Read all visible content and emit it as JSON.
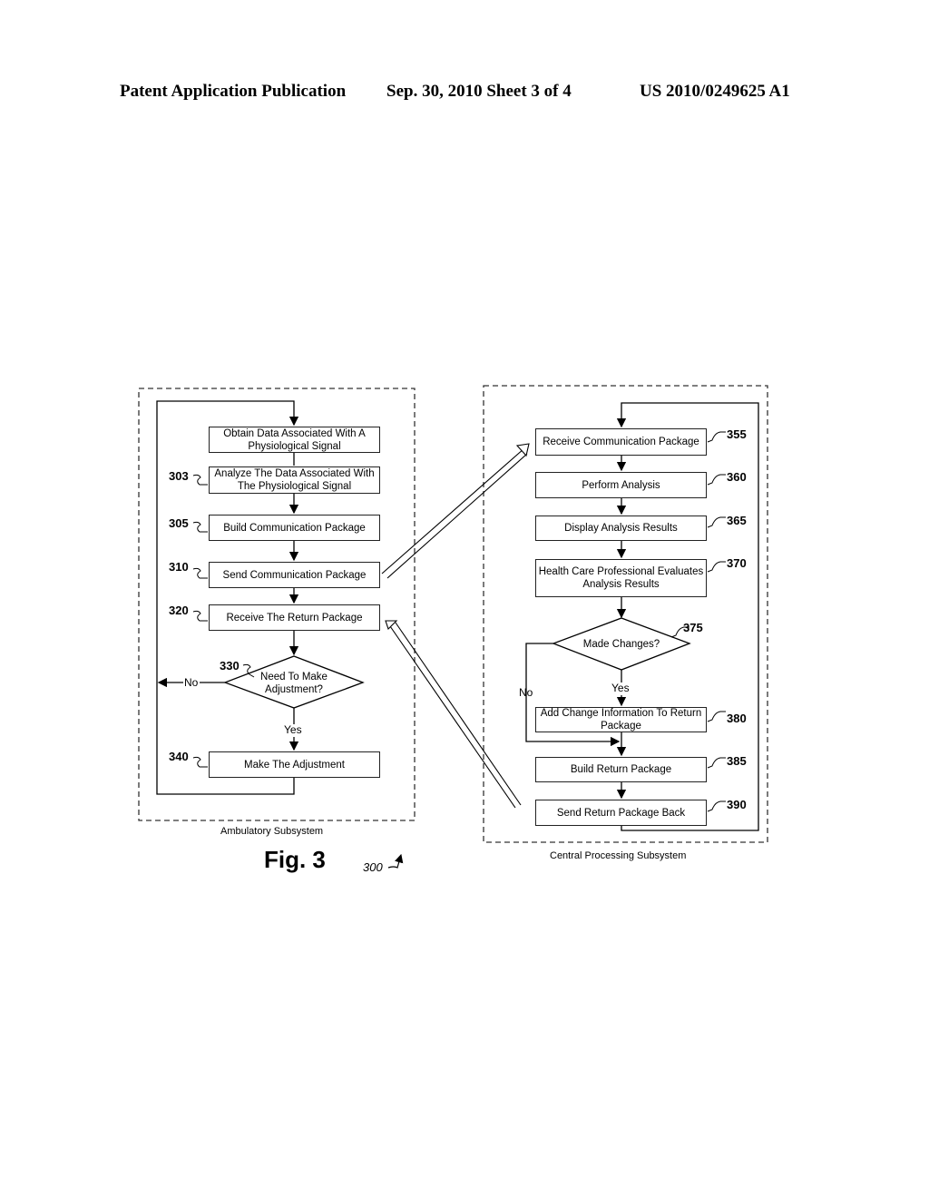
{
  "header": {
    "publication": "Patent Application Publication",
    "date_sheet": "Sep. 30, 2010   Sheet 3 of 4",
    "number": "US 2010/0249625 A1"
  },
  "figure": {
    "title": "Fig. 3",
    "ref": "300",
    "ambulatory": {
      "caption": "Ambulatory Subsystem",
      "steps": [
        {
          "ref": "",
          "text": "Obtain Data Associated With A Physiological Signal"
        },
        {
          "ref": "303",
          "text": "Analyze The Data Associated With The Physiological Signal"
        },
        {
          "ref": "305",
          "text": "Build Communication Package"
        },
        {
          "ref": "310",
          "text": "Send Communication Package"
        },
        {
          "ref": "320",
          "text": "Receive The Return Package"
        },
        {
          "ref": "340",
          "text": "Make The Adjustment"
        }
      ],
      "decision": {
        "ref": "330",
        "text": "Need To Make Adjustment?",
        "yes": "Yes",
        "no": "No"
      }
    },
    "central": {
      "caption": "Central Processing Subsystem",
      "steps": [
        {
          "ref": "355",
          "text": "Receive Communication Package"
        },
        {
          "ref": "360",
          "text": "Perform Analysis"
        },
        {
          "ref": "365",
          "text": "Display Analysis Results"
        },
        {
          "ref": "370",
          "text": "Health Care Professional Evaluates Analysis Results"
        },
        {
          "ref": "380",
          "text": "Add Change Information To Return Package"
        },
        {
          "ref": "385",
          "text": "Build Return Package"
        },
        {
          "ref": "390",
          "text": "Send Return Package Back"
        }
      ],
      "decision": {
        "ref": "375",
        "text": "Made Changes?",
        "yes": "Yes",
        "no": "No"
      }
    }
  }
}
